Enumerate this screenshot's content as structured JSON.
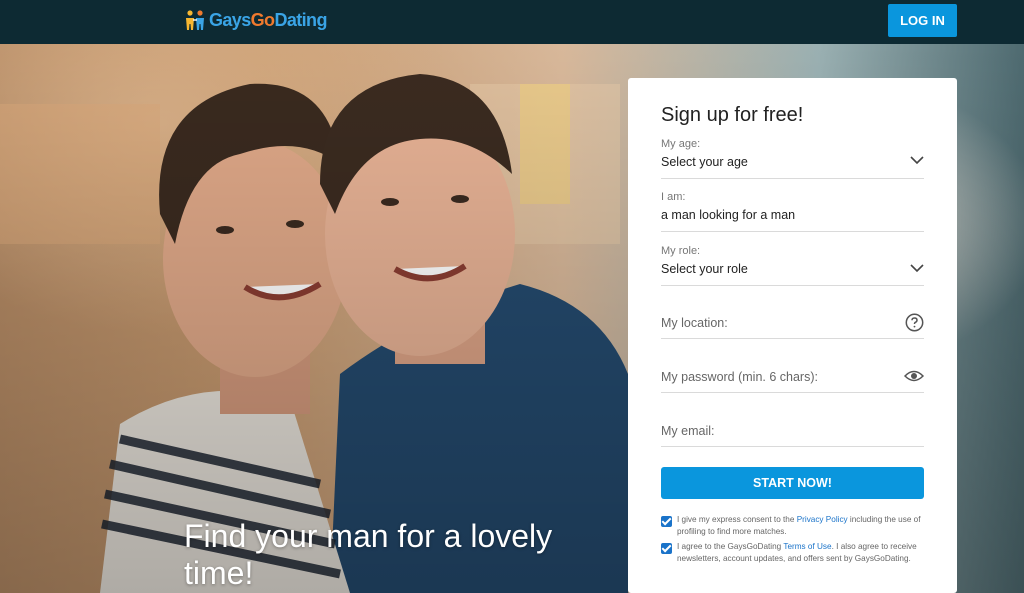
{
  "brand": {
    "logo_part1": "Gays",
    "logo_part2": "Go",
    "logo_part3": "Dating",
    "logo_icon": "people-icon",
    "accent": "#0a96dd",
    "header_bg": "#0d2a33"
  },
  "header": {
    "login_label": "LOG IN"
  },
  "hero": {
    "headline": "Find your man for a lovely time!"
  },
  "signup": {
    "title": "Sign up for free!",
    "age": {
      "label": "My age:",
      "value": "Select your age",
      "icon": "chevron-down-icon"
    },
    "iam": {
      "label": "I am:",
      "value": "a man looking for a man"
    },
    "role": {
      "label": "My role:",
      "value": "Select your role",
      "icon": "chevron-down-icon"
    },
    "location": {
      "placeholder": "My location:",
      "icon": "question-circle-icon"
    },
    "password": {
      "placeholder": "My password (min. 6 chars):",
      "icon": "eye-icon"
    },
    "email": {
      "placeholder": "My email:"
    },
    "submit_label": "START NOW!",
    "consent1": {
      "checked": true,
      "before": "I give my express consent to the ",
      "link": "Privacy Policy",
      "after": " including the use of profiling to find more matches."
    },
    "consent2": {
      "checked": true,
      "before": "I agree to the GaysGoDating ",
      "link": "Terms of Use",
      "after": ". I also agree to receive newsletters, account updates, and offers sent by GaysGoDating."
    }
  }
}
